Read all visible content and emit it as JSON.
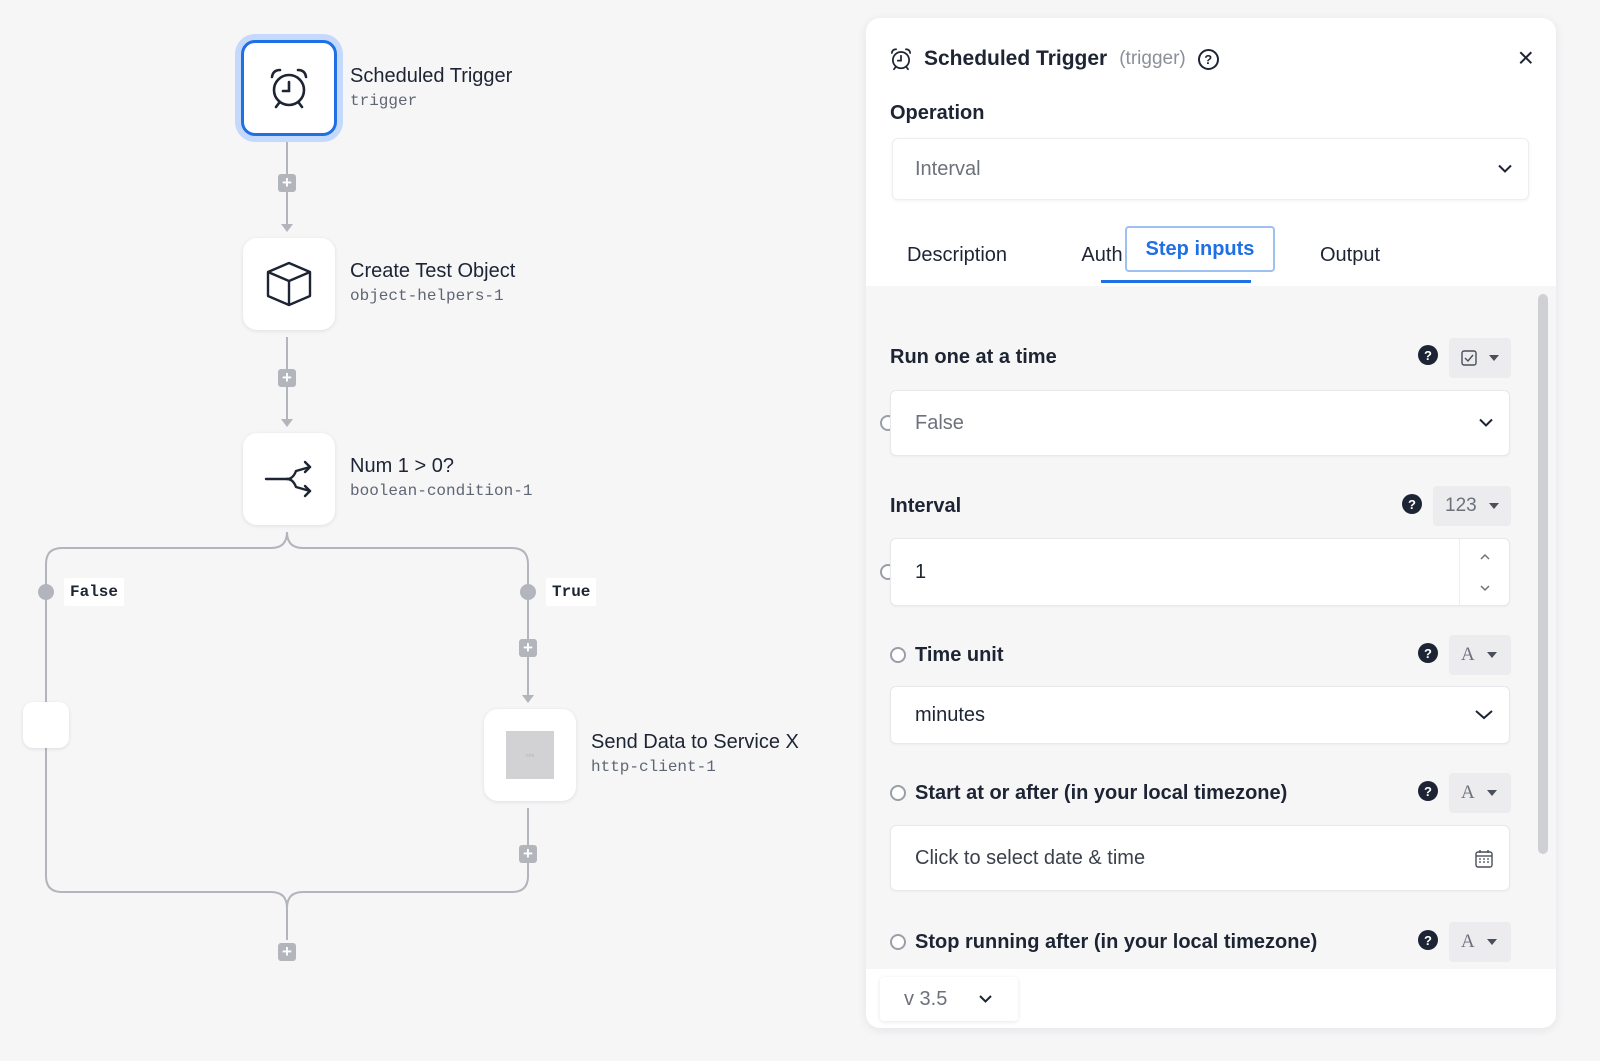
{
  "canvas": {
    "nodes": [
      {
        "title": "Scheduled Trigger",
        "subtitle": "trigger",
        "icon": "alarm-clock-icon"
      },
      {
        "title": "Create Test Object",
        "subtitle": "object-helpers-1",
        "icon": "cube-icon"
      },
      {
        "title": "Num 1 > 0?",
        "subtitle": "boolean-condition-1",
        "icon": "branch-icon"
      },
      {
        "title": "Send Data to Service X",
        "subtitle": "http-client-1",
        "icon": "placeholder-image-icon"
      }
    ],
    "branches": {
      "false_label": "False",
      "true_label": "True"
    },
    "add_symbol": "+"
  },
  "panel": {
    "title": "Scheduled Trigger",
    "kind": "(trigger)",
    "help_symbol": "?",
    "close_symbol": "×",
    "operation_label": "Operation",
    "operation_value": "Interval",
    "tabs": [
      {
        "label": "Description"
      },
      {
        "label": "Auth"
      },
      {
        "label": "Step inputs",
        "active": true
      },
      {
        "label": "Output"
      }
    ],
    "fields": {
      "run_one": {
        "label": "Run one at a time",
        "value": "False",
        "type_icon": "checkbox-icon"
      },
      "interval": {
        "label": "Interval",
        "value": "1",
        "type_label": "123"
      },
      "time_unit": {
        "label": "Time unit",
        "value": "minutes",
        "type_label": "A"
      },
      "start_at": {
        "label": "Start at or after (in your local timezone)",
        "placeholder": "Click to select date & time",
        "type_label": "A"
      },
      "stop_after": {
        "label": "Stop running after (in your local timezone)",
        "type_label": "A"
      }
    },
    "question_symbol": "?",
    "version": "v 3.5"
  },
  "colors": {
    "accent": "#1f6fe5",
    "connector": "#b3b5bc",
    "background": "#f6f6f7"
  }
}
